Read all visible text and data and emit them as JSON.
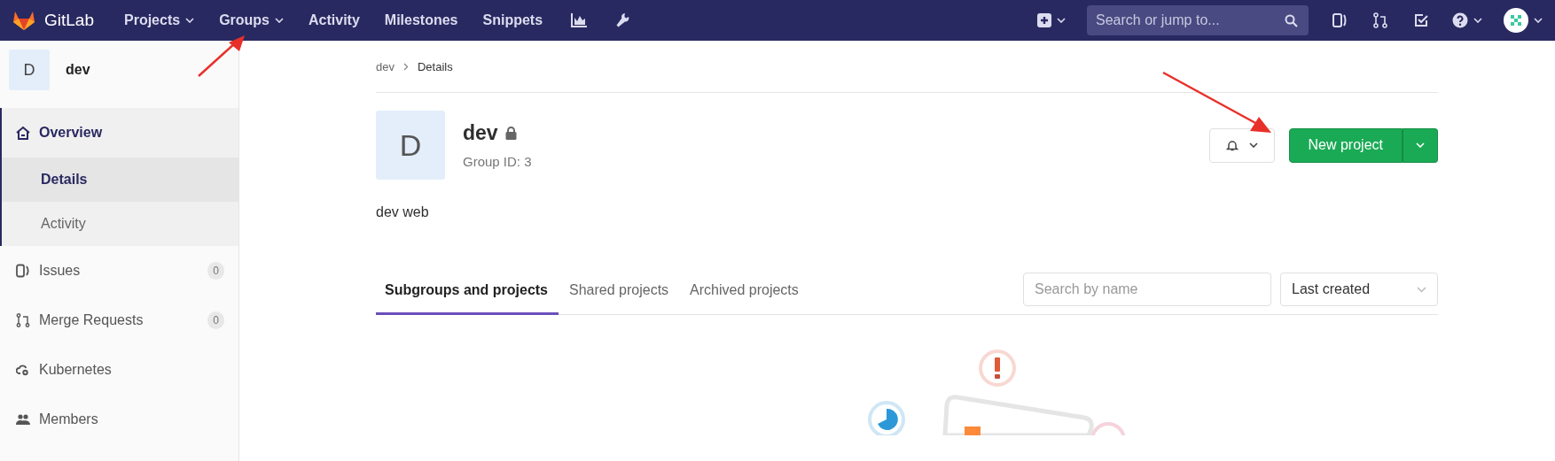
{
  "top_nav": {
    "logo_text": "GitLab",
    "links": [
      {
        "label": "Projects",
        "dropdown": true
      },
      {
        "label": "Groups",
        "dropdown": true
      },
      {
        "label": "Activity",
        "dropdown": false
      },
      {
        "label": "Milestones",
        "dropdown": false
      },
      {
        "label": "Snippets",
        "dropdown": false
      }
    ],
    "search": {
      "placeholder": "Search or jump to..."
    }
  },
  "sidebar": {
    "group": {
      "avatar_letter": "D",
      "name": "dev"
    },
    "items": [
      {
        "label": "Overview",
        "selected": true,
        "expanded": true,
        "children": [
          {
            "label": "Details",
            "selected": true
          },
          {
            "label": "Activity",
            "selected": false
          }
        ]
      },
      {
        "label": "Issues",
        "count": "0",
        "selected": false
      },
      {
        "label": "Merge Requests",
        "count": "0",
        "selected": false
      },
      {
        "label": "Kubernetes",
        "selected": false
      },
      {
        "label": "Members",
        "selected": false
      }
    ]
  },
  "breadcrumb": [
    "dev",
    "Details"
  ],
  "group": {
    "avatar_letter": "D",
    "name": "dev",
    "private": true,
    "id_text": "Group ID: 3",
    "description": "dev web"
  },
  "actions": {
    "primary": "New project"
  },
  "tabs": [
    {
      "label": "Subgroups and projects",
      "selected": true
    },
    {
      "label": "Shared projects",
      "selected": false
    },
    {
      "label": "Archived projects",
      "selected": false
    }
  ],
  "filter": {
    "placeholder": "Search by name",
    "sort": "Last created"
  }
}
